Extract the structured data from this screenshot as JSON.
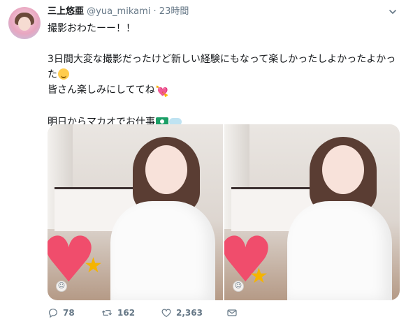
{
  "tweet": {
    "author_name": "三上悠亜",
    "author_handle": "@yua_mikami",
    "separator": "·",
    "timestamp": "23時間",
    "lines": [
      "撮影おわたーー！！",
      "",
      "3日間大変な撮影だったけど新しい経験にもなって楽しかったしよかったよかっ",
      "た",
      "皆さん楽しみにしててね",
      "",
      "明日からマカオでお仕事"
    ]
  },
  "actions": {
    "reply_count": "78",
    "retweet_count": "162",
    "like_count": "2,363"
  },
  "colors": {
    "text": "#14171a",
    "secondary": "#657786",
    "heart_emoji": "#e0245e"
  },
  "icons": {
    "avatar": "avatar",
    "more": "chevron-down-icon",
    "reply": "reply-icon",
    "retweet": "retweet-icon",
    "like": "heart-icon",
    "mail": "mail-icon"
  }
}
